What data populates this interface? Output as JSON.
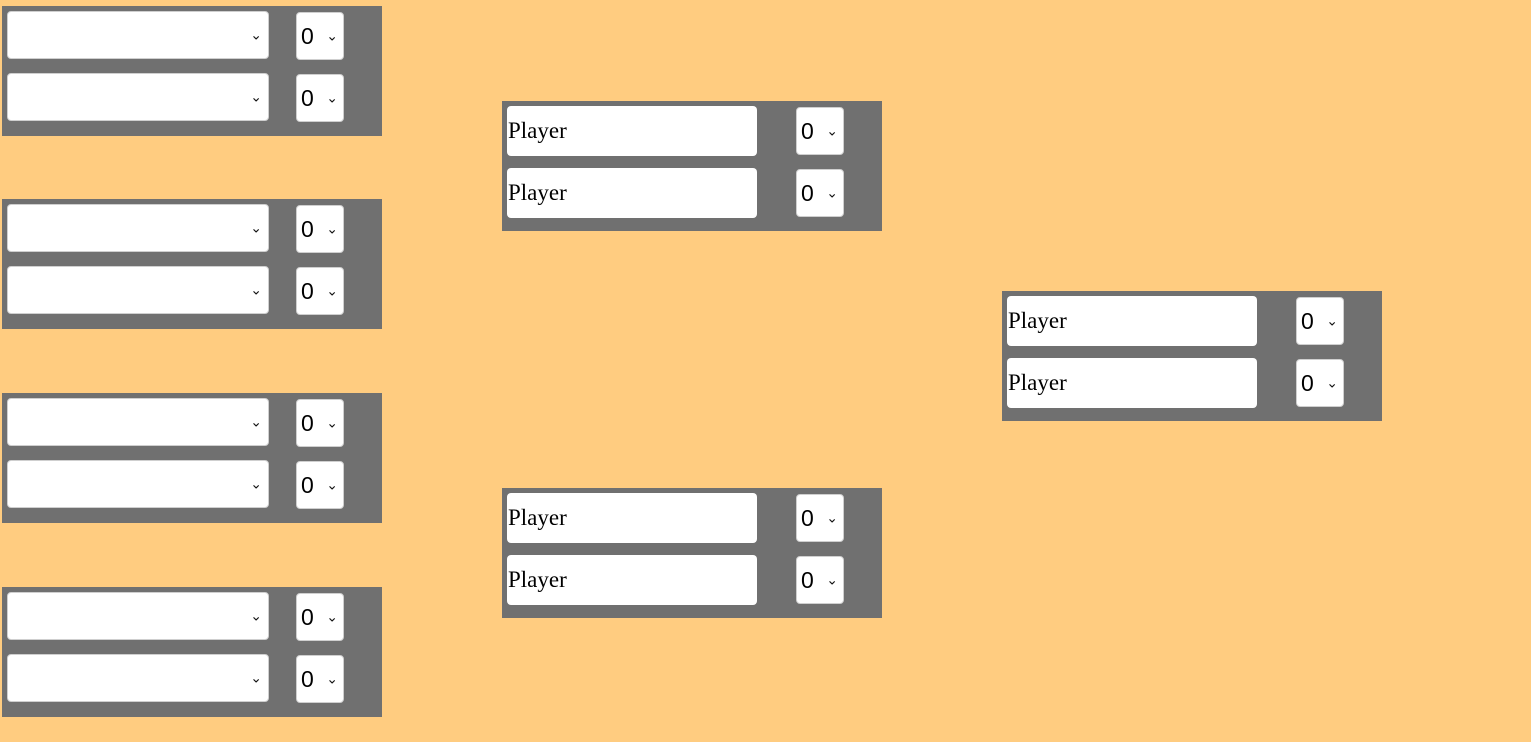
{
  "colors": {
    "background": "#FFCC80",
    "match_box": "#707070",
    "field": "#FFFFFF"
  },
  "icons": {
    "dropdown": "chevron-down-icon"
  },
  "round1": {
    "matches": [
      {
        "player1": {
          "selected": "",
          "score": "0"
        },
        "player2": {
          "selected": "",
          "score": "0"
        }
      },
      {
        "player1": {
          "selected": "",
          "score": "0"
        },
        "player2": {
          "selected": "",
          "score": "0"
        }
      },
      {
        "player1": {
          "selected": "",
          "score": "0"
        },
        "player2": {
          "selected": "",
          "score": "0"
        }
      },
      {
        "player1": {
          "selected": "",
          "score": "0"
        },
        "player2": {
          "selected": "",
          "score": "0"
        }
      }
    ]
  },
  "round2": {
    "matches": [
      {
        "player1": {
          "name": "Player",
          "score": "0"
        },
        "player2": {
          "name": "Player",
          "score": "0"
        }
      },
      {
        "player1": {
          "name": "Player",
          "score": "0"
        },
        "player2": {
          "name": "Player",
          "score": "0"
        }
      }
    ]
  },
  "final": {
    "player1": {
      "name": "Player",
      "score": "0"
    },
    "player2": {
      "name": "Player",
      "score": "0"
    }
  }
}
